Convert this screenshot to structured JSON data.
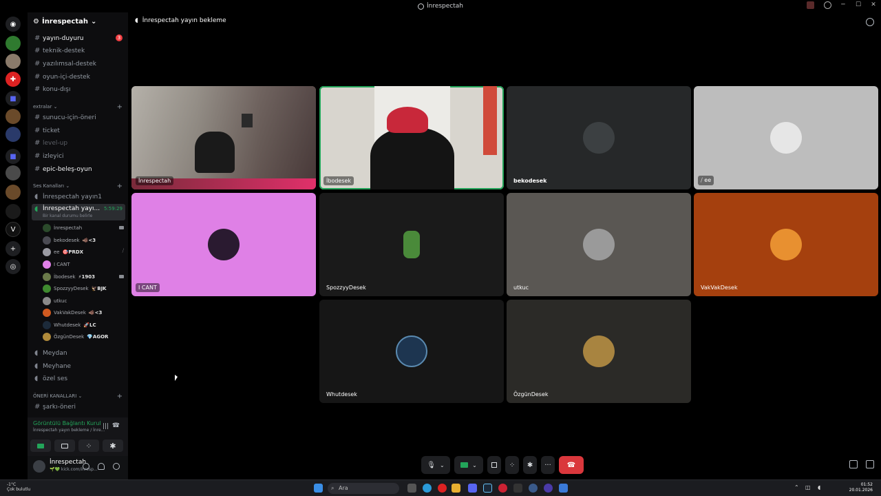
{
  "window": {
    "title": "İnrespectah"
  },
  "server": {
    "name": "İnrespectah"
  },
  "channels_top": [
    {
      "label": "yayın-duyuru",
      "bold": true,
      "badge": "3"
    },
    {
      "label": "teknik-destek"
    },
    {
      "label": "yazılımsal-destek"
    },
    {
      "label": "oyun-içi-destek"
    },
    {
      "label": "konu-dışı"
    }
  ],
  "cat_extras": "extralar",
  "channels_extras": [
    {
      "label": "sunucu-için-öneri"
    },
    {
      "label": "ticket"
    },
    {
      "label": "level-up",
      "dim": true
    },
    {
      "label": "izleyici"
    },
    {
      "label": "epic-beleş-oyun",
      "bold": true
    }
  ],
  "cat_voice": "Ses Kanalları",
  "voice_channels": [
    {
      "label": "İnrespectah yayın1"
    },
    {
      "label": "İnrespectah yayı...",
      "timer": "5:59:29",
      "status": "Bir kanal durumu belirle"
    }
  ],
  "voice_users": [
    {
      "name": "İnrespectah",
      "tag": "",
      "color": "#2b4a2b",
      "cam": true
    },
    {
      "name": "bekodesek",
      "tag": "🐗<3",
      "color": "#4a4a52"
    },
    {
      "name": "ee",
      "tag": "🎯PRDX",
      "color": "#9a9aa2"
    },
    {
      "name": "I CANT",
      "tag": "",
      "color": "#e080e8"
    },
    {
      "name": "İbodesek",
      "tag": "⚡1903",
      "color": "#6a7a4a",
      "cam": true
    },
    {
      "name": "SpozzyyDesek",
      "tag": "🦅BJK",
      "color": "#3f8a2f"
    },
    {
      "name": "utkuc",
      "tag": "",
      "color": "#8a8a8a"
    },
    {
      "name": "VakVakDesek",
      "tag": "🐗<3",
      "color": "#d05a20"
    },
    {
      "name": "Whutdesek",
      "tag": "🚀LC",
      "color": "#1c2a3a"
    },
    {
      "name": "ÖzgünDesek",
      "tag": "💎AGOR",
      "color": "#b08a3a"
    }
  ],
  "channels_bottom": [
    {
      "label": "Meydan"
    },
    {
      "label": "Meyhane"
    },
    {
      "label": "özel ses"
    }
  ],
  "cat_suggest": "ÖNERİ KANALLARI",
  "channels_suggest": [
    {
      "label": "şarkı-öneri"
    }
  ],
  "voice_panel": {
    "status": "Görüntülü Bağlantı Kurul",
    "sub": "İnrespectah yayın bekleme / İnre..."
  },
  "user_panel": {
    "name": "İnrespectah",
    "sub": "🌱💚 kick.com/inresp..."
  },
  "call": {
    "channel_title": "İnrespectah yayın bekleme",
    "tiles": [
      {
        "name": "İnrespectah",
        "bg": "#5a5550",
        "pic": ""
      },
      {
        "name": "İbodesek",
        "bg": "#c9c6bf",
        "pic": "#1c1c1c",
        "speaking": true
      },
      {
        "name": "bekodesek",
        "bg": "#262829",
        "pic": "#3c4042"
      },
      {
        "name": "ee",
        "bg": "#bdbdbd",
        "pic": "#e6e6e6"
      },
      {
        "name": "I CANT",
        "bg": "#df80e6",
        "pic": "#2a1a30"
      },
      {
        "name": "SpozzyyDesek",
        "bg": "#1a1a1a",
        "pic": "#4a8a3a"
      },
      {
        "name": "utkuc",
        "bg": "#5a5753",
        "pic": "#9a9a9a"
      },
      {
        "name": "VakVakDesek",
        "bg": "#a5400e",
        "pic": "#e89030"
      },
      {
        "name": "Whutdesek",
        "bg": "#161616",
        "pic": "#1d3550"
      },
      {
        "name": "ÖzgünDesek",
        "bg": "#2b2a27",
        "pic": "#a88440"
      }
    ]
  },
  "taskbar": {
    "weather_temp": "-1°C",
    "weather_desc": "Çok bulutlu",
    "search_placeholder": "Ara",
    "time": "01:52",
    "date": "20.01.2026"
  }
}
